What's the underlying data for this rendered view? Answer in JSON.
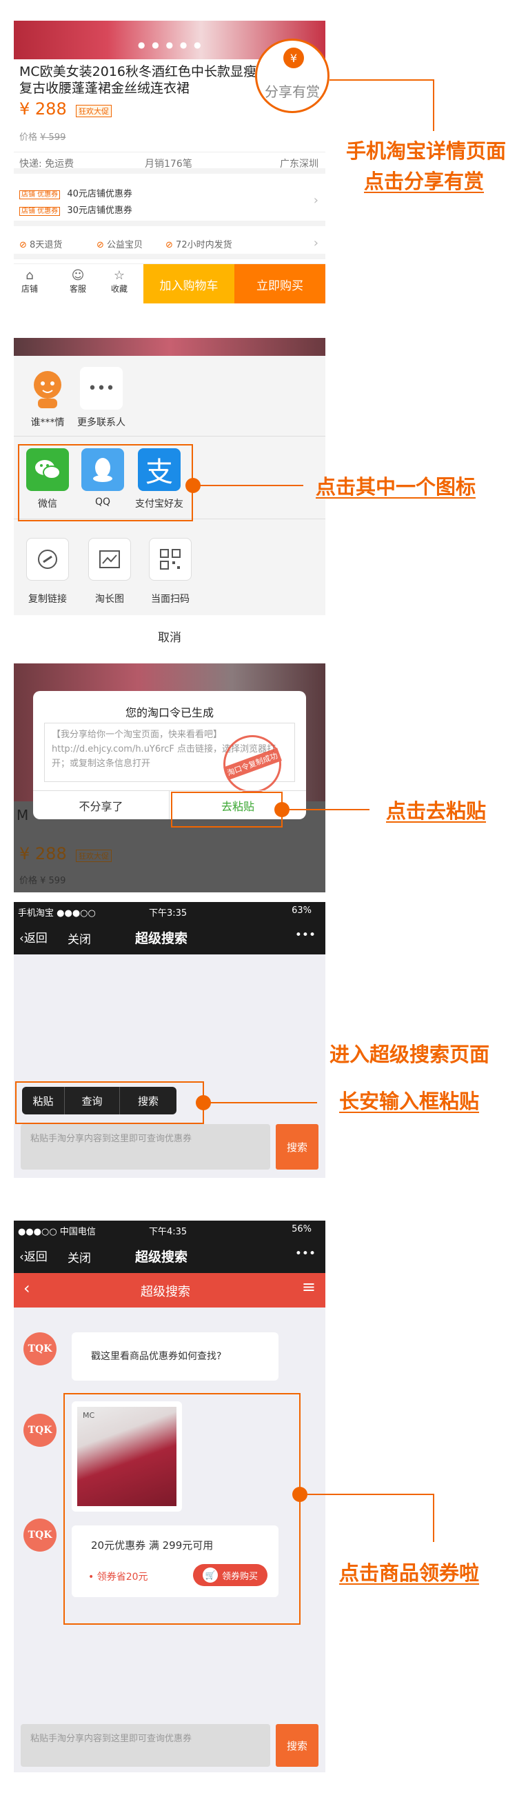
{
  "colors": {
    "accent": "#f16500",
    "orange_btn": "#ff7a00",
    "yellow_btn": "#ffb400",
    "red_bar": "#e64b3c"
  },
  "step1": {
    "title_line1": "MC欧美女装2016秋冬酒红色中长款显瘦",
    "title_line2": "复古收腰蓬蓬裙金丝绒连衣裙",
    "price": "¥ 288",
    "badge": "狂欢大促",
    "orig_price_label": "价格",
    "orig_price": "¥ 599",
    "shipping": "快递: 免运费",
    "sales": "月销176笔",
    "location": "广东深圳",
    "coupon_tag": "店铺 优惠券",
    "coupon1": "40元店铺优惠券",
    "coupon2": "30元店铺优惠券",
    "services": [
      "8天退货",
      "公益宝贝",
      "72小时内发货"
    ],
    "tabs": [
      "店铺",
      "客服",
      "收藏"
    ],
    "add_cart": "加入购物车",
    "buy_now": "立即购买",
    "share_label": "分享有赏",
    "share_icon": "¥",
    "caption1": "手机淘宝详情页面",
    "caption2": "点击分享有赏"
  },
  "step2": {
    "contacts": [
      "谁***情",
      "更多联系人"
    ],
    "share_apps": [
      "微信",
      "QQ",
      "支付宝好友"
    ],
    "tools": [
      "复制链接",
      "淘长图",
      "当面扫码"
    ],
    "cancel": "取消",
    "caption": "点击其中一个图标"
  },
  "step3": {
    "dialog_title": "您的淘口令已生成",
    "dialog_body": "【我分享给你一个淘宝页面，快来看看吧】http://d.ehjcy.com/h.uY6rcF 点击链接，选择浏览器打开；或复制这条信息打开",
    "stamp": "淘口令复制成功",
    "btn_cancel": "不分享了",
    "btn_paste": "去粘贴",
    "bg_price": "¥ 288",
    "bg_badge": "狂欢大促",
    "bg_orig": "价格 ¥ 599",
    "bg_letter": "M",
    "caption": "点击去粘贴"
  },
  "step4": {
    "status_left": "手机淘宝 ●●●○○",
    "status_time": "下午3:35",
    "status_right": "63%",
    "back": "返回",
    "close": "关闭",
    "title": "超级搜索",
    "more": "•••",
    "menu": [
      "粘贴",
      "查询",
      "搜索"
    ],
    "placeholder": "粘贴手淘分享内容到这里即可查询优惠券",
    "search_btn": "搜索",
    "caption1": "进入超级搜索页面",
    "caption2": "长安输入框粘贴"
  },
  "step5": {
    "status_left": "●●●○○ 中国电信",
    "status_time": "下午4:35",
    "status_right": "56%",
    "back": "返回",
    "close": "关闭",
    "title": "超级搜索",
    "more": "•••",
    "bar_title": "超级搜索",
    "avatar_text": "TQK",
    "msg1": "戳这里看商品优惠券如何查找?",
    "product_brand": "MC",
    "coupon_title": "20元优惠券 满 299元可用",
    "coupon_save": "领券省20元",
    "coupon_btn": "领券购买",
    "placeholder": "粘贴手淘分享内容到这里即可查询优惠券",
    "search_btn": "搜索",
    "caption": "点击商品领券啦"
  }
}
